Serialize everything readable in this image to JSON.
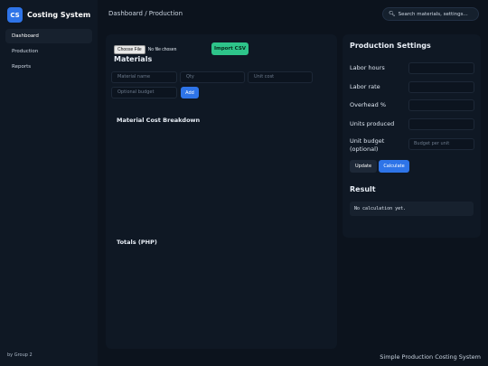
{
  "brand": {
    "logo": "CS",
    "name": "Costing System"
  },
  "nav": {
    "items": [
      {
        "label": "Dashboard",
        "active": true
      },
      {
        "label": "Production",
        "active": false
      },
      {
        "label": "Reports",
        "active": false
      }
    ]
  },
  "sidebar": {
    "credit": "by Group 2"
  },
  "header": {
    "breadcrumb": "Dashboard / Production",
    "search_placeholder": "Search materials, settings..."
  },
  "materials": {
    "file_button": "Choose File",
    "file_status": "No file chosen",
    "import_label": "Import CSV",
    "title": "Materials",
    "name_placeholder": "Material name",
    "qty_placeholder": "Qty",
    "cost_placeholder": "Unit cost",
    "budget_placeholder": "Optional budget",
    "add_label": "Add",
    "breakdown_title": "Material Cost Breakdown",
    "totals_title": "Totals (PHP)"
  },
  "settings": {
    "title": "Production Settings",
    "fields": [
      {
        "label": "Labor hours",
        "placeholder": ""
      },
      {
        "label": "Labor rate",
        "placeholder": ""
      },
      {
        "label": "Overhead %",
        "placeholder": ""
      },
      {
        "label": "Units produced",
        "placeholder": ""
      },
      {
        "label": "Unit budget (optional)",
        "placeholder": "Budget per unit"
      }
    ],
    "update_label": "Update",
    "calculate_label": "Calculate"
  },
  "result": {
    "title": "Result",
    "text": "No calculation yet."
  },
  "footer": {
    "text": "Simple Production Costing System"
  },
  "colors": {
    "accent": "#2e74e8",
    "import_green": "#2ec48a",
    "background": "#0c131d"
  }
}
